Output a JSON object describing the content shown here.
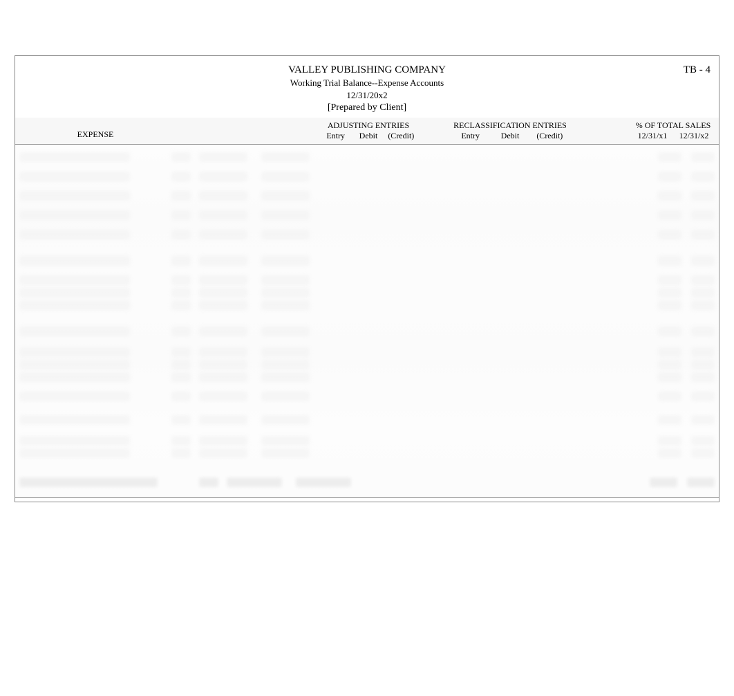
{
  "page_ref": "TB - 4",
  "company_name": "VALLEY PUBLISHING COMPANY",
  "report_title": "Working Trial Balance--Expense Accounts",
  "as_of_date": "12/31/20x2",
  "prepared_by": "[Prepared by Client]",
  "column_headers": {
    "expense": "EXPENSE",
    "adjusting_entries": {
      "group": "ADJUSTING ENTRIES",
      "entry": "Entry",
      "debit": "Debit",
      "credit": "(Credit)"
    },
    "reclass_entries": {
      "group": "RECLASSIFICATION ENTRIES",
      "entry": "Entry",
      "debit": "Debit",
      "credit": "(Credit)"
    },
    "pct_total_sales": {
      "group": "% OF TOTAL SALES",
      "col1": "12/31/x1",
      "col2": "12/31/x2"
    }
  },
  "note": "Table body content is obscured/blurred in the source image; individual row values are not legible."
}
